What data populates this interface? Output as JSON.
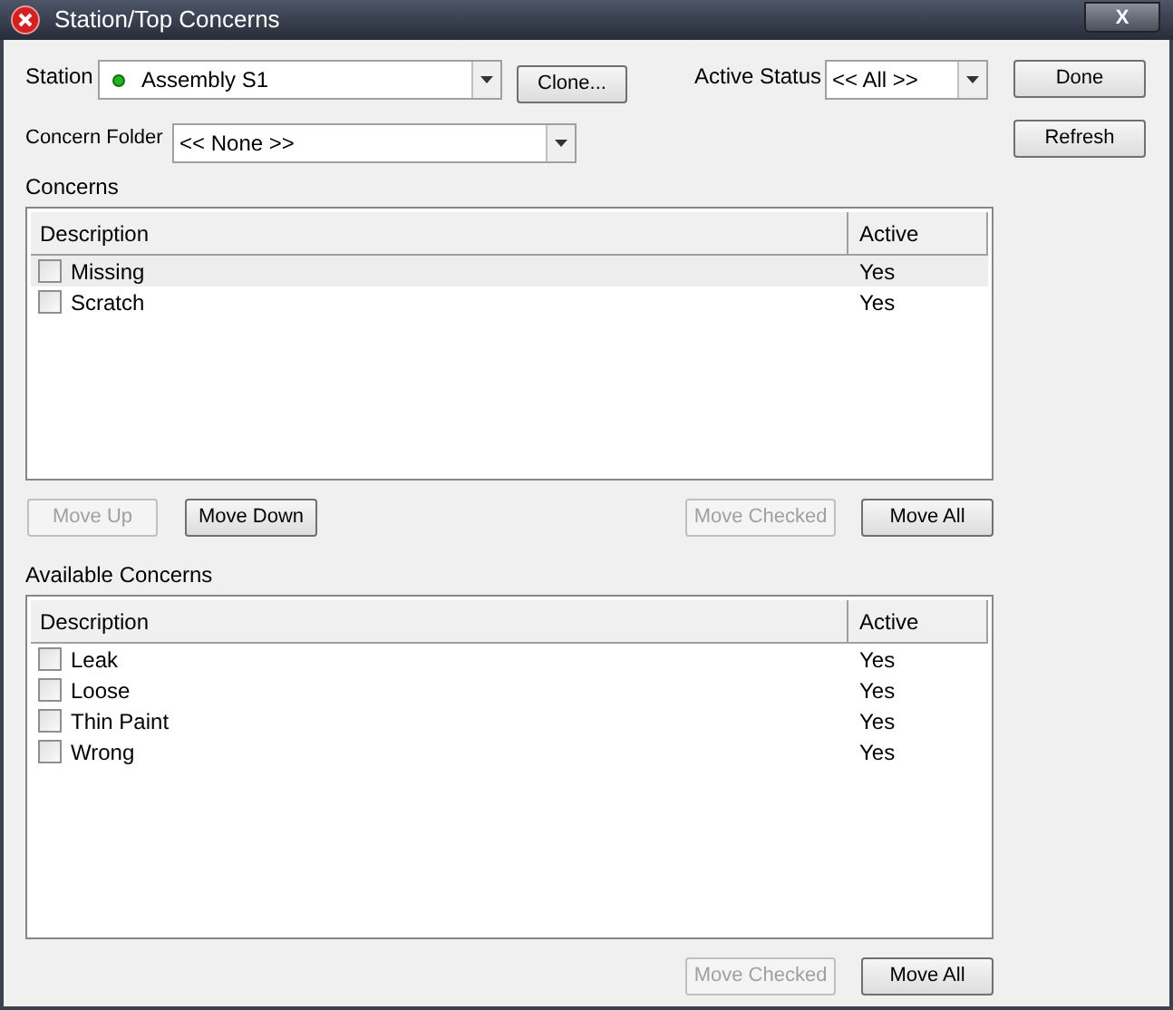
{
  "window": {
    "title": "Station/Top Concerns",
    "close_label": "X"
  },
  "station": {
    "label": "Station",
    "value": "Assembly S1"
  },
  "clone_button": {
    "label": "Clone...",
    "disabled": false
  },
  "active_status": {
    "label": "Active Status",
    "value": "<< All >>"
  },
  "concern_folder": {
    "label": "Concern Folder",
    "value": "<< None >>"
  },
  "side_buttons": [
    {
      "label": "Done",
      "disabled": false
    },
    {
      "label": "Refresh",
      "disabled": false
    }
  ],
  "concerns": {
    "label": "Concerns",
    "columns": [
      "Description",
      "Active"
    ],
    "rows": [
      {
        "description": "Missing",
        "active": "Yes",
        "checked": false,
        "selected": true
      },
      {
        "description": "Scratch",
        "active": "Yes",
        "checked": false,
        "selected": false
      }
    ],
    "buttons_left": [
      {
        "label": "Move Up",
        "disabled": true
      },
      {
        "label": "Move Down",
        "disabled": false
      }
    ],
    "buttons_right": [
      {
        "label": "Move Checked",
        "disabled": true
      },
      {
        "label": "Move All",
        "disabled": false
      }
    ]
  },
  "available": {
    "label": "Available Concerns",
    "columns": [
      "Description",
      "Active"
    ],
    "rows": [
      {
        "description": "Leak",
        "active": "Yes",
        "checked": false,
        "selected": false
      },
      {
        "description": "Loose",
        "active": "Yes",
        "checked": false,
        "selected": false
      },
      {
        "description": "Thin Paint",
        "active": "Yes",
        "checked": false,
        "selected": false
      },
      {
        "description": "Wrong",
        "active": "Yes",
        "checked": false,
        "selected": false
      }
    ],
    "buttons_right": [
      {
        "label": "Move Checked",
        "disabled": true
      },
      {
        "label": "Move All",
        "disabled": false
      }
    ]
  }
}
